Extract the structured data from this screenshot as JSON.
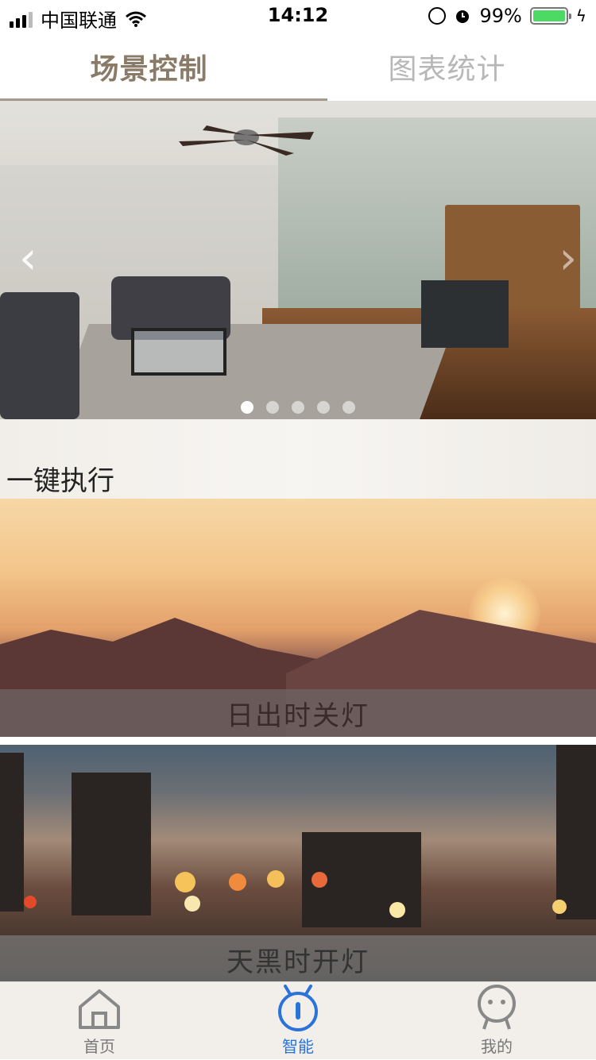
{
  "status_bar": {
    "carrier": "中国联通",
    "time": "14:12",
    "battery": "99%"
  },
  "top_tabs": [
    {
      "label": "场景控制",
      "active": true
    },
    {
      "label": "图表统计",
      "active": false
    }
  ],
  "banner": {
    "image": "living-room-photo",
    "slide_count": 5,
    "active_slide": 1
  },
  "section": {
    "title": "一键执行"
  },
  "scenes": [
    {
      "label": "日出时关灯",
      "image": "sunrise-mountains-photo"
    },
    {
      "label": "天黑时开灯",
      "image": "city-night-bokeh-photo"
    }
  ],
  "tab_bar": {
    "items": [
      {
        "label": "首页",
        "icon": "home-icon",
        "active": false
      },
      {
        "label": "智能",
        "icon": "smart-robot-icon",
        "active": true
      },
      {
        "label": "我的",
        "icon": "profile-icon",
        "active": false
      }
    ],
    "colors": {
      "active": "#2a74d9",
      "inactive": "#777777"
    }
  }
}
